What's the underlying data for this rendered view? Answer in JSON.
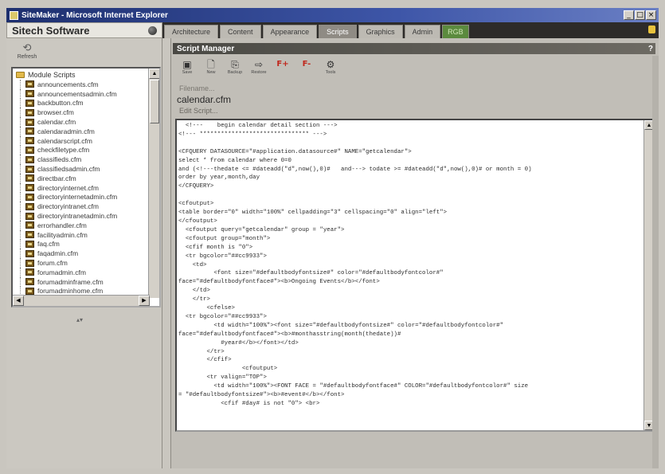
{
  "window": {
    "title": "SiteMaker - Microsoft Internet Explorer",
    "buttons": [
      "_",
      "□",
      "×"
    ]
  },
  "brand": {
    "name": "Sitech Software",
    "icon": "globe-icon"
  },
  "tabs": [
    {
      "label": "Architecture",
      "active": false
    },
    {
      "label": "Content",
      "active": false
    },
    {
      "label": "Appearance",
      "active": false
    },
    {
      "label": "Scripts",
      "active": true
    },
    {
      "label": "Graphics",
      "active": false
    },
    {
      "label": "Admin",
      "active": false
    },
    {
      "label": "RGB",
      "active": false
    }
  ],
  "sidebar": {
    "refresh_label": "Refresh",
    "root_label": "Module Scripts",
    "items": [
      "announcements.cfm",
      "announcementsadmin.cfm",
      "backbutton.cfm",
      "browser.cfm",
      "calendar.cfm",
      "calendaradmin.cfm",
      "calendarscript.cfm",
      "checkfiletype.cfm",
      "classifieds.cfm",
      "classifiedsadmin.cfm",
      "directbar.cfm",
      "directoryinternet.cfm",
      "directoryinternetadmin.cfm",
      "directoryintranet.cfm",
      "directoryintranetadmin.cfm",
      "errorhandler.cfm",
      "facilityadmin.cfm",
      "faq.cfm",
      "faqadmin.cfm",
      "forum.cfm",
      "forumadmin.cfm",
      "forumadminframe.cfm",
      "forumadminhome.cfm"
    ]
  },
  "script_manager": {
    "title": "Script Manager",
    "help": "?",
    "toolbar": [
      {
        "label": "Save",
        "glyph": "▣"
      },
      {
        "label": "New",
        "glyph": "🗋"
      },
      {
        "label": "Backup",
        "glyph": "⎘"
      },
      {
        "label": "Restore",
        "glyph": "⇨"
      },
      {
        "label": "",
        "glyph": "F+",
        "red": true
      },
      {
        "label": "",
        "glyph": "F-",
        "red": true
      },
      {
        "label": "Tools",
        "glyph": "⚙"
      }
    ],
    "filename_label": "Filename...",
    "filename": "calendar.cfm",
    "edit_label": "Edit Script...",
    "code": "  <!---    begin calendar detail section --->\n<!--- ******************************* --->\n\n<CFQUERY DATASOURCE=\"#application.datasource#\" NAME=\"getcalendar\">\nselect * from calendar where 0=0\nand (<!---thedate <= #dateadd(\"d\",now(),0)#   and---> todate >= #dateadd(\"d\",now(),0)# or month = 0)\norder by year,month,day\n</CFQUERY>\n\n<cfoutput>\n<table border=\"0\" width=\"100%\" cellpadding=\"3\" cellspacing=\"0\" align=\"left\">\n</cfoutput>\n  <cfoutput query=\"getcalendar\" group = \"year\">\n  <cfoutput group=\"month\">\n  <cfif month is \"0\">\n  <tr bgcolor=\"##cc9933\">\n    <td>\n          <font size=\"#defaultbodyfontsize#\" color=\"#defaultbodyfontcolor#\"\nface=\"#defaultbodyfontface#\"><b>Ongoing Events</b></font>\n    </td>\n    </tr>\n        <cfelse>\n  <tr bgcolor=\"##cc9933\">\n          <td width=\"100%\"><font size=\"#defaultbodyfontsize#\" color=\"#defaultbodyfontcolor#\"\nface=\"#defaultbodyfontface#\"><b>#monthasstring(month(thedate))#\n            #year#</b></font></td>\n        </tr>\n        </cfif>\n                  <cfoutput>\n        <tr valign=\"TOP\">\n          <td width=\"100%\"><FONT FACE = \"#defaultbodyfontface#\" COLOR=\"#defaultbodyfontcolor#\" size\n= \"#defaultbodyfontsize#\"><b>#event#</b></font>\n            <cfif #day# is not \"0\"> <br>"
  }
}
